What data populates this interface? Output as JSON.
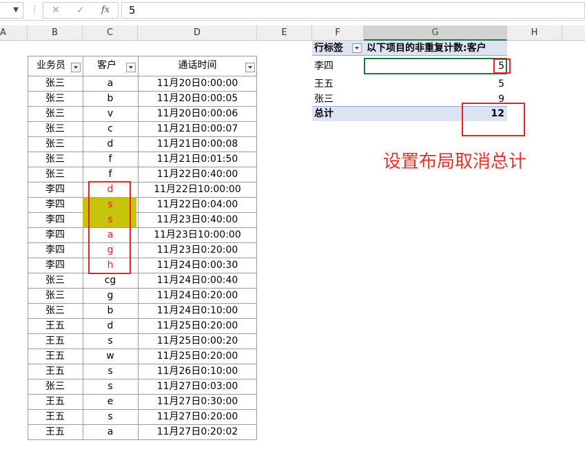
{
  "formula_bar": {
    "cancel_label": "✕",
    "enter_label": "✓",
    "fx_label": "fx",
    "value": "5"
  },
  "columns": [
    "A",
    "B",
    "C",
    "D",
    "E",
    "F",
    "G",
    "H"
  ],
  "table": {
    "headers": [
      "业务员",
      "客户",
      "通话时间"
    ],
    "rows": [
      [
        "张三",
        "a",
        "11月20日0:00:00"
      ],
      [
        "张三",
        "b",
        "11月20日0:00:05"
      ],
      [
        "张三",
        "v",
        "11月20日0:00:06"
      ],
      [
        "张三",
        "c",
        "11月21日0:00:07"
      ],
      [
        "张三",
        "d",
        "11月21日0:00:08"
      ],
      [
        "张三",
        "f",
        "11月21日0:01:50"
      ],
      [
        "张三",
        "f",
        "11月22日0:40:00"
      ],
      [
        "李四",
        "d",
        "11月22日10:00:00"
      ],
      [
        "李四",
        "s",
        "11月22日0:04:00"
      ],
      [
        "李四",
        "s",
        "11月23日0:40:00"
      ],
      [
        "李四",
        "a",
        "11月23日10:00:00"
      ],
      [
        "李四",
        "g",
        "11月23日0:20:00"
      ],
      [
        "李四",
        "h",
        "11月24日0:00:30"
      ],
      [
        "张三",
        "cg",
        "11月24日0:00:40"
      ],
      [
        "张三",
        "g",
        "11月24日0:20:00"
      ],
      [
        "张三",
        "b",
        "11月24日0:10:00"
      ],
      [
        "王五",
        "d",
        "11月25日0:20:00"
      ],
      [
        "王五",
        "s",
        "11月25日0:00:20"
      ],
      [
        "王五",
        "w",
        "11月25日0:20:00"
      ],
      [
        "王五",
        "s",
        "11月26日0:10:00"
      ],
      [
        "张三",
        "s",
        "11月27日0:03:00"
      ],
      [
        "王五",
        "e",
        "11月27日0:30:00"
      ],
      [
        "王五",
        "s",
        "11月27日0:20:00"
      ],
      [
        "王五",
        "a",
        "11月27日0:20:02"
      ]
    ]
  },
  "pivot": {
    "row_label_header": "行标签",
    "value_header": "以下项目的非重复计数:客户",
    "rows": [
      {
        "label": "李四",
        "value": "5"
      },
      {
        "label": "王五",
        "value": "5"
      },
      {
        "label": "张三",
        "value": "9"
      }
    ],
    "total_label": "总计",
    "total_value": "12"
  },
  "annotation": "设置布局取消总计",
  "colors": {
    "highlight": "#c6c30a",
    "annotation_red": "#e5322d",
    "pivot_header_bg": "#dce3f3",
    "selected_column": "#217346"
  }
}
